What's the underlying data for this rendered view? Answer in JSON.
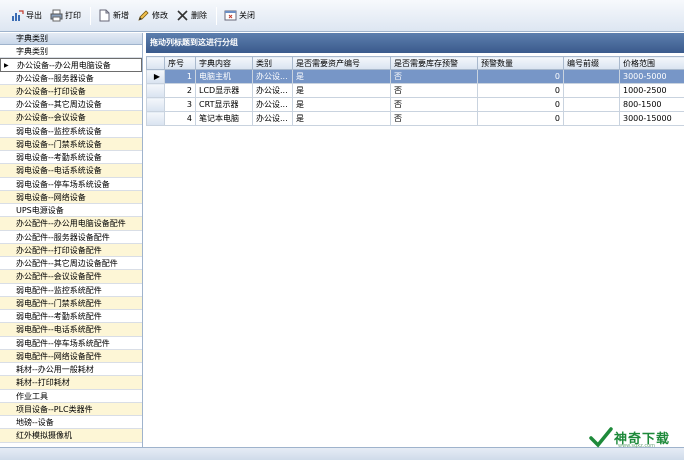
{
  "toolbar": {
    "export": "导出",
    "print": "打印",
    "add": "新增",
    "edit": "修改",
    "delete": "删除",
    "close": "关闭"
  },
  "left_panel": {
    "header": "字典类别",
    "items": [
      "字典类别",
      "办公设备--办公用电脑设备",
      "办公设备--服务器设备",
      "办公设备--打印设备",
      "办公设备--其它周边设备",
      "办公设备--会议设备",
      "弱电设备--监控系统设备",
      "弱电设备--门禁系统设备",
      "弱电设备--考勤系统设备",
      "弱电设备--电话系统设备",
      "弱电设备--停车场系统设备",
      "弱电设备--网络设备",
      "UPS电源设备",
      "办公配件--办公用电脑设备配件",
      "办公配件--服务器设备配件",
      "办公配件--打印设备配件",
      "办公配件--其它周边设备配件",
      "办公配件--会议设备配件",
      "弱电配件--监控系统配件",
      "弱电配件--门禁系统配件",
      "弱电配件--考勤系统配件",
      "弱电配件--电话系统配件",
      "弱电配件--停车场系统配件",
      "弱电配件--网络设备配件",
      "耗材--办公用一般耗材",
      "耗材--打印耗材",
      "作业工具",
      "项目设备--PLC类器件",
      "地磅--设备",
      "红外模拟摄像机"
    ],
    "selected_index": 1
  },
  "group_bar": "拖动列标题到这进行分组",
  "grid": {
    "columns": [
      "序号",
      "字典内容",
      "类别",
      "是否需要资产编号",
      "是否需要库存预警",
      "预警数量",
      "编号前缀",
      "价格范围"
    ],
    "rows": [
      [
        "1",
        "电脑主机",
        "办公设...",
        "是",
        "否",
        "0",
        "",
        "3000-5000"
      ],
      [
        "2",
        "LCD显示器",
        "办公设...",
        "是",
        "否",
        "0",
        "",
        "1000-2500"
      ],
      [
        "3",
        "CRT显示器",
        "办公设...",
        "是",
        "否",
        "0",
        "",
        "800-1500"
      ],
      [
        "4",
        "笔记本电脑",
        "办公设...",
        "是",
        "否",
        "0",
        "",
        "3000-15000"
      ]
    ],
    "selected_row": 0
  },
  "watermark": {
    "text": "神奇下载",
    "sub": "www.sqxz.com"
  },
  "colors": {
    "selection": "#7796c7",
    "group_bar": "#3a5a8c",
    "alt_row": "#fdf6d6",
    "watermark": "#1e8a3a"
  }
}
